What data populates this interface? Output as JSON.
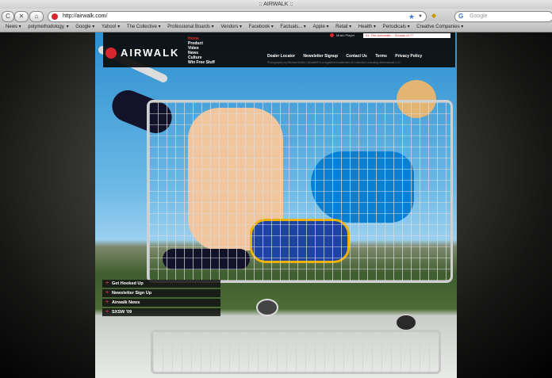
{
  "window": {
    "title": ":: AIRWALK ::"
  },
  "toolbar": {
    "back_label": "C",
    "stop_label": "✕",
    "home_label": "⌂",
    "url": "http://airwalk.com/",
    "search_placeholder": "Google"
  },
  "bookmarks": [
    "News ▾",
    "polymethodology. ▾",
    "Google ▾",
    "Yahoo! ▾",
    "The Collective ▾",
    "Professional Boards ▾",
    "Vendors ▾",
    "Facebook ▾",
    "Factuals... ▾",
    "Apple ▾",
    "Retail ▾",
    "Health ▾",
    "Periodicals ▾",
    "Creative Companies ▾"
  ],
  "site": {
    "logo_text": "AIRWALK",
    "menu": [
      "Home",
      "Product",
      "Video",
      "News",
      "Culture",
      "Win Free Stuff"
    ],
    "music_player": {
      "label": "Music Player",
      "track": "01. The Automatic :: Sounds of 77"
    },
    "header_links": [
      "Dealer Locator",
      "Newsletter Signup",
      "Contact Us",
      "Terms",
      "Privacy Policy"
    ],
    "credit": "Photography by Michael Muller | Airwalk® is a registered trademark of Collective Licensing International LLC.",
    "side_menu": [
      "Get Hooked Up",
      "Newsletter Sign Up",
      "Airwalk News",
      "SXSW '09"
    ]
  }
}
